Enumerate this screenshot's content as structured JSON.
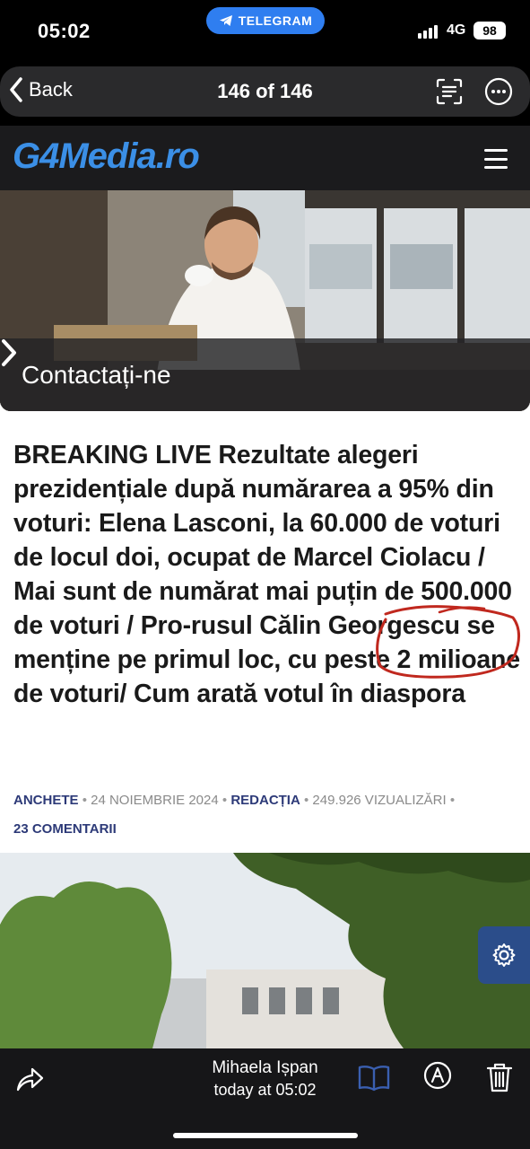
{
  "status_bar": {
    "time": "05:02",
    "app_pill": "TELEGRAM",
    "network": "4G",
    "battery": "98"
  },
  "viewer_nav": {
    "back_label": "Back",
    "counter": "146 of 146"
  },
  "site": {
    "logo": "G4Media.ro",
    "brand_color": "#3b8fe6"
  },
  "hero": {
    "cta_label": "Contactați-ne"
  },
  "article": {
    "headline": "BREAKING LIVE Rezultate alegeri prezidențiale după numărarea a 95% din voturi: Elena Lasconi, la 60.000 de voturi de locul doi, ocupat de Marcel Ciolacu / Mai sunt de numărat mai puțin de 500.000 de voturi / Pro-rusul Călin Georgescu se menține pe primul loc, cu peste 2 milioane de voturi/ Cum arată votul în diaspora",
    "category": "ANCHETE",
    "date": "24 NOIEMBRIE 2024",
    "author": "REDACȚIA",
    "views": "249.926 VIZUALIZĂRI",
    "comments": "23 COMENTARII",
    "separator": "•",
    "accent_color": "#2d3a78"
  },
  "annotation": {
    "color": "#c0281e"
  },
  "toolbar": {
    "sender_name": "Mihaela Ișpan",
    "sender_time": "today at 05:02"
  }
}
